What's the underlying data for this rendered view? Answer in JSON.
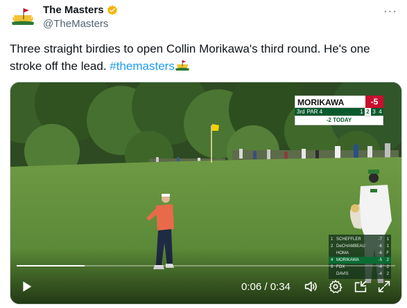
{
  "tweet": {
    "display_name": "The Masters",
    "handle": "@TheMasters",
    "more_label": "···",
    "text": "Three straight birdies to open Collin Morikawa's third round. He's one stroke off the lead.",
    "hashtag": "#themasters"
  },
  "scorebug": {
    "player": "MORIKAWA",
    "score": "-5",
    "round": "3rd",
    "hole": "PAR 4",
    "holes": [
      "1",
      "2",
      "3",
      "4"
    ],
    "current_hole_index": 1,
    "today": "-2 TODAY"
  },
  "leaderboard": [
    {
      "pos": "1",
      "name": "SCHEFFLER",
      "score": "-7",
      "thru": "1",
      "highlight": false
    },
    {
      "pos": "2",
      "name": "DeCHAMBEAU",
      "score": "-6",
      "thru": "1",
      "highlight": false
    },
    {
      "pos": "",
      "name": "HOMA",
      "score": "-6",
      "thru": "F",
      "highlight": false
    },
    {
      "pos": "4",
      "name": "MORIKAWA",
      "score": "-5",
      "thru": "2",
      "highlight": true
    },
    {
      "pos": "5",
      "name": "FOX",
      "score": "-4",
      "thru": "2",
      "highlight": false
    },
    {
      "pos": "",
      "name": "DAVIS",
      "score": "-4",
      "thru": "2",
      "highlight": false
    }
  ],
  "player_controls": {
    "current_time": "0:06",
    "duration": "0:34",
    "time_display": "0:06 / 0:34",
    "progress": 0.18
  },
  "colors": {
    "hashtag": "#1d9bf0",
    "verified": "#f4b400",
    "scorebug_red": "#c8102e",
    "masters_green": "#0b5a2e"
  }
}
